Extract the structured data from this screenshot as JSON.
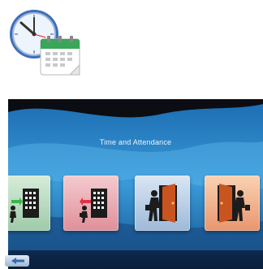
{
  "screen": {
    "title": "Time and Attendance"
  },
  "icons": {
    "app": "clock-calendar-icon",
    "tiles": [
      "clock-in-building-icon",
      "clock-out-building-icon",
      "enter-door-icon",
      "exit-door-icon"
    ],
    "back": "back-arrow-icon"
  },
  "colors": {
    "tile_green": "#b7dcc0",
    "tile_pink": "#eaa6af",
    "tile_blue": "#b8cde4",
    "tile_orange": "#f0aa80",
    "in_arrow": "#39b54a",
    "out_arrow": "#e2324a",
    "screen_wave": "#2e8fd0",
    "bottom_bar": "#0d2a4f"
  }
}
